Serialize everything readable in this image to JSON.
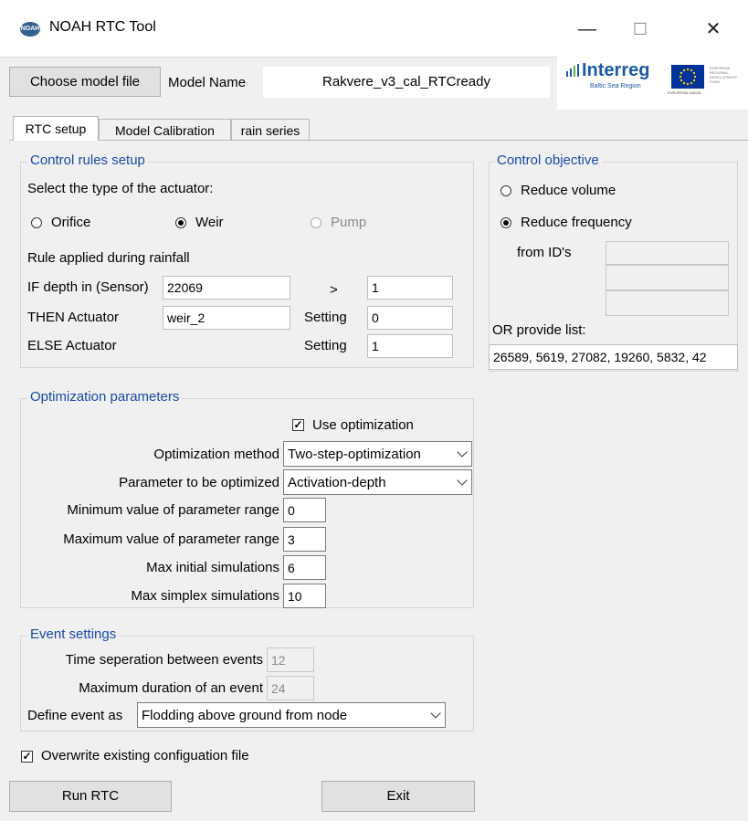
{
  "window": {
    "title": "NOAH RTC Tool",
    "icon_text": "NOAH",
    "minimize": "—",
    "maximize": "☐",
    "close": "✕"
  },
  "header": {
    "choose_model_label": "Choose model file",
    "model_name_label": "Model Name",
    "model_name_value": "Rakvere_v3_cal_RTCready",
    "logo": {
      "name": "Interreg",
      "subtitle": "Baltic Sea Region",
      "eu_text": "EUROPEAN UNION",
      "fund_text": "EUROPEAN REGIONAL DEVELOPMENT FUND"
    }
  },
  "tabs": [
    {
      "label": "RTC setup",
      "active": true
    },
    {
      "label": "Model Calibration",
      "active": false
    },
    {
      "label": "rain series",
      "active": false
    }
  ],
  "control_rules": {
    "title": "Control rules setup",
    "actuator_prompt": "Select the type of the actuator:",
    "actuators": [
      {
        "label": "Orifice",
        "selected": false,
        "enabled": true
      },
      {
        "label": "Weir",
        "selected": true,
        "enabled": true
      },
      {
        "label": "Pump",
        "selected": false,
        "enabled": false
      }
    ],
    "rule_heading": "Rule applied during rainfall",
    "if_label": "IF depth in (Sensor)",
    "if_value": "22069",
    "operator": ">",
    "threshold": "1",
    "then_label": "THEN Actuator",
    "then_value": "weir_2",
    "setting_label": "Setting",
    "then_setting": "0",
    "else_label": "ELSE Actuator",
    "else_setting": "1"
  },
  "control_objective": {
    "title": "Control objective",
    "options": [
      {
        "label": "Reduce volume",
        "selected": false
      },
      {
        "label": "Reduce frequency",
        "selected": true
      }
    ],
    "from_ids_label": "from ID's",
    "list_label": "OR provide list:",
    "list_value": "26589, 5619, 27082, 19260, 5832, 42"
  },
  "optimization": {
    "title": "Optimization parameters",
    "use_label": "Use optimization",
    "use_checked": true,
    "method_label": "Optimization method",
    "method_value": "Two-step-optimization",
    "param_label": "Parameter to be optimized",
    "param_value": "Activation-depth",
    "min_label": "Minimum value of parameter range",
    "min_value": "0",
    "max_label": "Maximum value of parameter range",
    "max_value": "3",
    "max_init_label": "Max initial simulations",
    "max_init_value": "6",
    "max_simplex_label": "Max simplex simulations",
    "max_simplex_value": "10"
  },
  "events": {
    "title": "Event settings",
    "separation_label": "Time seperation between events",
    "separation_value": "12",
    "duration_label": "Maximum duration of an event",
    "duration_value": "24",
    "define_label": "Define event as",
    "define_value": "Flodding above ground from node"
  },
  "footer": {
    "overwrite_label": "Overwrite existing configuation file",
    "overwrite_checked": true,
    "run_label": "Run RTC",
    "exit_label": "Exit"
  },
  "colors": {
    "group_title": "#1b4aa8",
    "window_bg": "#f0f0f0",
    "interreg_blue": "#1e5aa8",
    "eu_blue": "#003399",
    "eu_star": "#ffcc00"
  }
}
